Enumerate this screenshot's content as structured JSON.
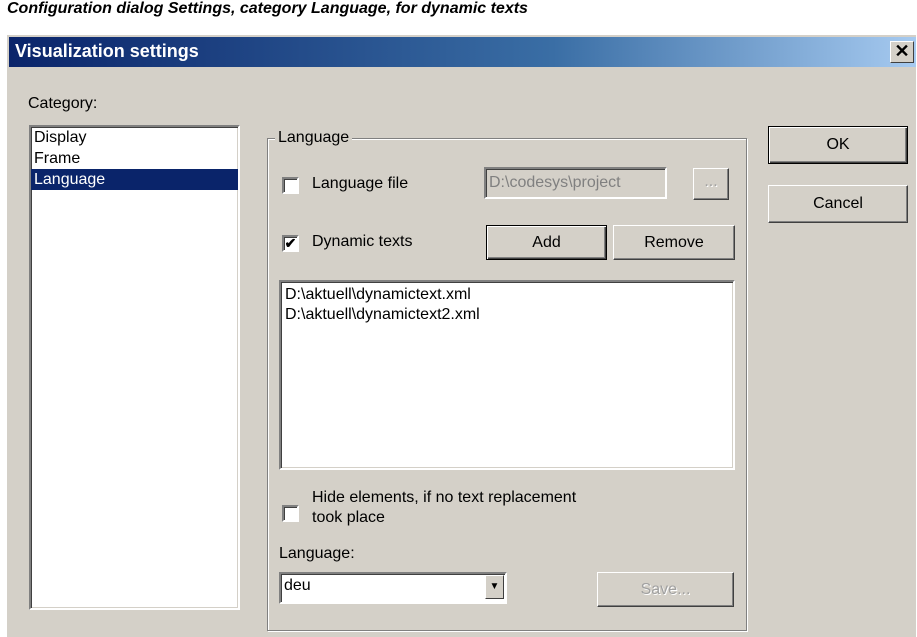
{
  "caption": "Configuration dialog Settings, category Language, for dynamic texts",
  "window": {
    "title": "Visualization settings",
    "close_glyph": "✕"
  },
  "category": {
    "label": "Category:",
    "items": [
      {
        "label": "Display",
        "selected": false
      },
      {
        "label": "Frame",
        "selected": false
      },
      {
        "label": "Language",
        "selected": true
      }
    ]
  },
  "language_group": {
    "legend": "Language",
    "language_file": {
      "label": "Language file",
      "checked": false,
      "path": "D:\\codesys\\project",
      "browse_label": "..."
    },
    "dynamic_texts": {
      "label": "Dynamic texts",
      "checked": true,
      "add_label": "Add",
      "remove_label": "Remove"
    },
    "files": [
      "D:\\aktuell\\dynamictext.xml",
      "D:\\aktuell\\dynamictext2.xml"
    ],
    "hide_elements": {
      "label_line1": "Hide elements, if no text replacement",
      "label_line2": "took place",
      "checked": false
    },
    "language_label": "Language:",
    "language_value": "deu",
    "save_label": "Save..."
  },
  "buttons": {
    "ok": "OK",
    "cancel": "Cancel"
  },
  "colors": {
    "title_gradient_start": "#0a246a",
    "title_gradient_end": "#a6caf0",
    "dialog_bg": "#d4d0c8",
    "selection": "#0a246a"
  },
  "icons": {
    "check": "✔",
    "dropdown_arrow": "▼",
    "close": "close-icon"
  }
}
